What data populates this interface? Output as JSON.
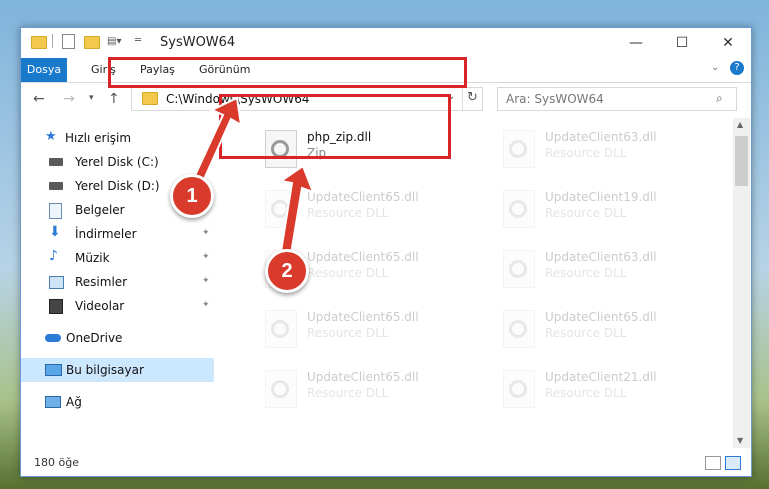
{
  "window": {
    "title": "SysWOW64"
  },
  "ribbon": {
    "tabs": [
      "Dosya",
      "Giriş",
      "Paylaş",
      "Görünüm"
    ]
  },
  "address": {
    "path": "C:\\Windows\\SysWOW64",
    "search_placeholder": "Ara: SysWOW64"
  },
  "nav": {
    "items": [
      {
        "label": "Hızlı erişim"
      },
      {
        "label": "Yerel Disk (C:)"
      },
      {
        "label": "Yerel Disk (D:)"
      },
      {
        "label": "Belgeler"
      },
      {
        "label": "İndirmeler"
      },
      {
        "label": "Müzik"
      },
      {
        "label": "Resimler"
      },
      {
        "label": "Videolar"
      },
      {
        "label": "OneDrive"
      },
      {
        "label": "Bu bilgisayar"
      },
      {
        "label": "Ağ"
      }
    ]
  },
  "files": {
    "highlighted": {
      "name": "php_zip.dll",
      "type": "Zip"
    },
    "tiles": [
      {
        "name": "UpdateClient63.dll",
        "type": "Resource DLL"
      },
      {
        "name": "UpdateClient65.dll",
        "type": "Resource DLL"
      },
      {
        "name": "UpdateClient19.dll",
        "type": "Resource DLL"
      },
      {
        "name": "UpdateClient65.dll",
        "type": "Resource DLL"
      },
      {
        "name": "UpdateClient63.dll",
        "type": "Resource DLL"
      },
      {
        "name": "UpdateClient65.dll",
        "type": "Resource DLL"
      },
      {
        "name": "UpdateClient65.dll",
        "type": "Resource DLL"
      },
      {
        "name": "UpdateClient65.dll",
        "type": "Resource DLL"
      },
      {
        "name": "UpdateClient21.dll",
        "type": "Resource DLL"
      }
    ]
  },
  "status": {
    "count": "180 öğe"
  },
  "badges": {
    "one": "1",
    "two": "2"
  },
  "colors": {
    "accent": "#1979ca",
    "highlight": "#d9252a"
  }
}
